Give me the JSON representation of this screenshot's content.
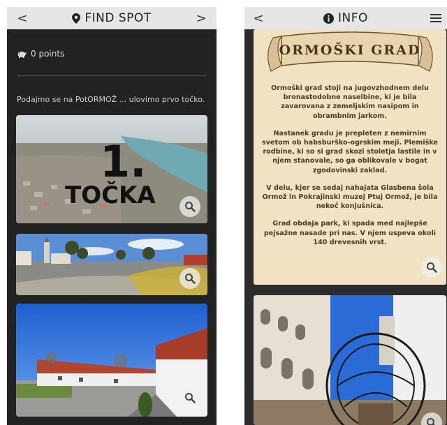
{
  "left": {
    "topbar": {
      "back": "<",
      "title": "FIND SPOT",
      "forward": ">"
    },
    "points_text": "0 points",
    "intro": "Podajmo se na PotORMOŽ ... ulovimo prvo točko.",
    "hero": {
      "number": "1.",
      "word": "TOČKA"
    },
    "icons": {
      "pin": "map-pin-icon",
      "piggy": "piggy-bank-icon",
      "zoom": "magnifier-icon"
    }
  },
  "right": {
    "topbar": {
      "back": "<",
      "title": "INFO",
      "menu": "≡"
    },
    "banner_title": "ORMOŠKI GRAD",
    "paragraphs": [
      "Ormoški grad stoji na jugovzhodnem delu bronastodobne naselbine, ki je bila zavarovana z zemeljskim nasipom in obrambnim jarkom.",
      "Nastanek gradu je prepleten z nemirnim svetom ob habsburško-ogrskim meji. Plemiške rodbine, ki so si grad skozi stoletja lastile in v njem stanovale, so ga oblikovale v bogat zgodovinski zaklad.",
      "V delu, kjer se sedaj nahajata Glasbena šola Ormož in Pokrajinski muzej Ptuj Ormož, je bila nekoč konjušnica.",
      "Grad obdaja park, ki spada med najlepše pejsažne nasade pri nas. V njem uspeva okoli 140 drevesnih vrst."
    ],
    "icons": {
      "info": "info-circle-icon",
      "menu": "hamburger-menu-icon"
    }
  },
  "colors": {
    "topbar": "#e6e6e6",
    "dark_bg": "#222222",
    "parchment": "#f0e2c2",
    "parchment_text": "#4a3b25"
  }
}
